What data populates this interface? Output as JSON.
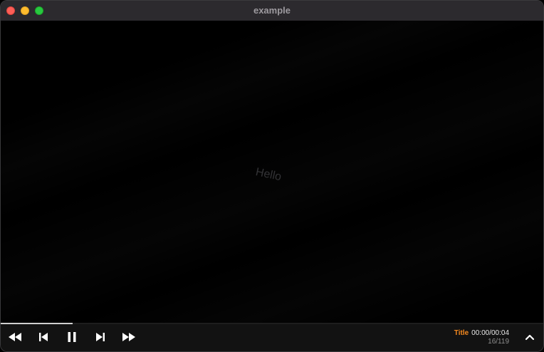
{
  "window": {
    "title": "example"
  },
  "video": {
    "overlay_text": "Hello"
  },
  "player": {
    "title_label": "Title",
    "time": "00:00/00:04",
    "frames": "16/119",
    "progress": 0.133
  },
  "icons": {
    "rewind": "fast-rewind-icon",
    "previous": "skip-previous-icon",
    "pause": "pause-icon",
    "next": "skip-next-icon",
    "forward": "fast-forward-icon",
    "expand": "chevron-up-icon"
  },
  "colors": {
    "accent": "#f5891f",
    "close": "#fe5f57",
    "minimize": "#febc2e",
    "zoom": "#28c840"
  }
}
